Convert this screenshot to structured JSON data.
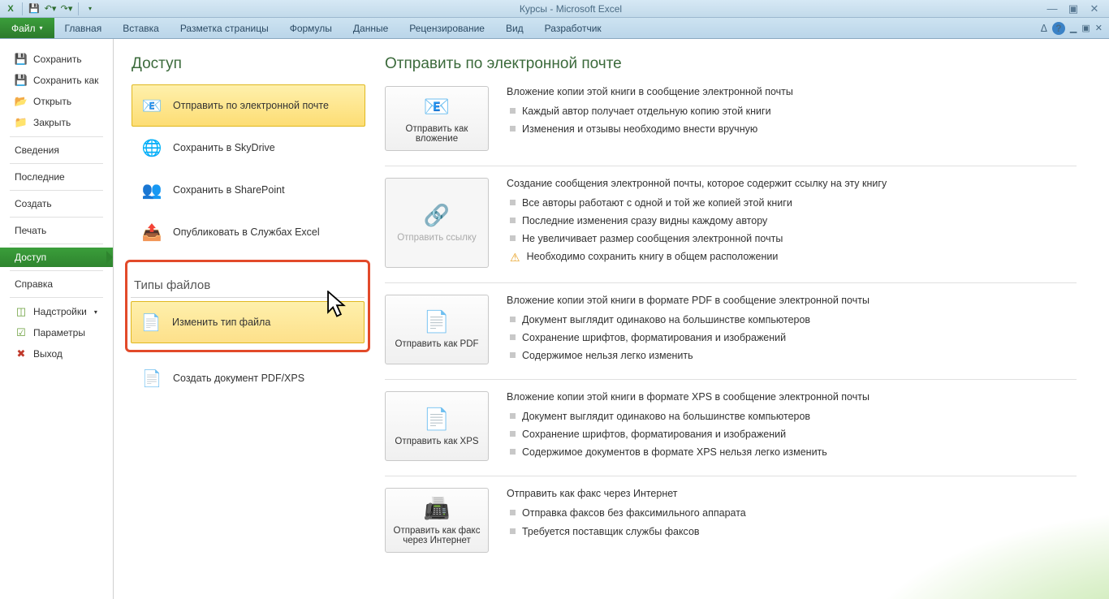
{
  "title": "Курсы  -  Microsoft Excel",
  "ribbon": {
    "file": "Файл",
    "tabs": [
      "Главная",
      "Вставка",
      "Разметка страницы",
      "Формулы",
      "Данные",
      "Рецензирование",
      "Вид",
      "Разработчик"
    ]
  },
  "sidebar": {
    "save": "Сохранить",
    "save_as": "Сохранить как",
    "open": "Открыть",
    "close": "Закрыть",
    "info": "Сведения",
    "recent": "Последние",
    "new": "Создать",
    "print": "Печать",
    "share": "Доступ",
    "help": "Справка",
    "addins": "Надстройки",
    "options": "Параметры",
    "exit": "Выход"
  },
  "middle": {
    "title": "Доступ",
    "send_email": "Отправить по электронной почте",
    "skydrive": "Сохранить в SkyDrive",
    "sharepoint": "Сохранить в SharePoint",
    "publish_excel": "Опубликовать в Службах Excel",
    "file_types_title": "Типы файлов",
    "change_type": "Изменить тип файла",
    "create_pdf": "Создать документ PDF/XPS"
  },
  "right": {
    "title": "Отправить по электронной почте",
    "btn_attach": "Отправить как вложение",
    "btn_link": "Отправить ссылку",
    "btn_pdf": "Отправить как PDF",
    "btn_xps": "Отправить как XPS",
    "btn_fax": "Отправить как факс через Интернет",
    "attach": {
      "head": "Вложение копии этой книги в сообщение электронной почты",
      "items": [
        "Каждый автор получает отдельную копию этой книги",
        "Изменения и отзывы необходимо внести вручную"
      ]
    },
    "link": {
      "head": "Создание сообщения электронной почты, которое содержит ссылку на эту книгу",
      "items": [
        "Все авторы работают с одной и той же копией этой книги",
        "Последние изменения сразу видны каждому автору",
        "Не увеличивает размер сообщения электронной почты"
      ],
      "warn": "Необходимо сохранить книгу в общем расположении"
    },
    "pdf": {
      "head": "Вложение копии этой книги в формате PDF в сообщение электронной почты",
      "items": [
        "Документ выглядит одинаково на большинстве компьютеров",
        "Сохранение шрифтов, форматирования и изображений",
        "Содержимое нельзя легко изменить"
      ]
    },
    "xps": {
      "head": "Вложение копии этой книги в формате XPS в сообщение электронной почты",
      "items": [
        "Документ выглядит одинаково на большинстве компьютеров",
        "Сохранение шрифтов, форматирования и изображений",
        "Содержимое документов в формате XPS нельзя легко изменить"
      ]
    },
    "fax": {
      "head": "Отправить как факс через Интернет",
      "items": [
        "Отправка факсов без факсимильного аппарата",
        "Требуется поставщик службы факсов"
      ]
    }
  }
}
